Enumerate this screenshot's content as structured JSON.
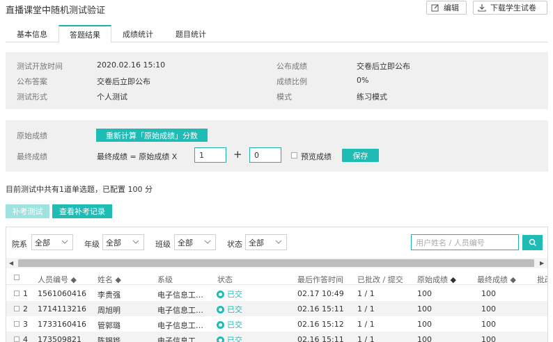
{
  "header": {
    "title": "直播课堂中随机测试验证",
    "edit_label": "编辑",
    "download_label": "下载学生试卷"
  },
  "tabs": [
    {
      "label": "基本信息"
    },
    {
      "label": "答题结果",
      "active": true
    },
    {
      "label": "成绩统计"
    },
    {
      "label": "题目统计"
    }
  ],
  "info": {
    "open_time_label": "测试开放时间",
    "open_time_value": "2020.02.16 15:10",
    "publish_score_label": "公布成绩",
    "publish_score_value": "交卷后立即公布",
    "publish_answer_label": "公布答案",
    "publish_answer_value": "交卷后立即公布",
    "score_ratio_label": "成绩比例",
    "score_ratio_value": "0%",
    "test_form_label": "测试形式",
    "test_form_value": "个人测试",
    "mode_label": "模式",
    "mode_value": "练习模式"
  },
  "score": {
    "raw_label": "原始成绩",
    "recalc_button": "重新计算「原始成绩」分数",
    "final_label": "最终成绩",
    "formula_text": "最终成绩 = 原始成绩 X",
    "multiplier": "1",
    "plus": "+",
    "offset": "0",
    "preview_label": "预览成绩",
    "save_button": "保存"
  },
  "summary": "目前测试中共有1道单选题，已配置 100 分",
  "actions": {
    "makeup_test": "补考测试",
    "view_makeup": "查看补考记录"
  },
  "filters": {
    "college_label": "院系",
    "college_value": "全部",
    "grade_label": "年级",
    "grade_value": "全部",
    "class_label": "班级",
    "class_value": "全部",
    "status_label": "状态",
    "status_value": "全部",
    "search_placeholder": "用户姓名 / 人员编号"
  },
  "table": {
    "columns": [
      "人员编号",
      "姓名",
      "系级",
      "状态",
      "最后作答时间",
      "已批改 / 提交",
      "原始成绩",
      "最终成绩",
      "批改"
    ],
    "rows": [
      {
        "index": "1",
        "id": "1561060416",
        "name": "李贵强",
        "dept": "电子信息工程系",
        "status": "已交",
        "time": "02.17 10:49",
        "graded": "1 / 1",
        "raw": "100",
        "final": "100"
      },
      {
        "index": "2",
        "id": "1714113216",
        "name": "周旭明",
        "dept": "电子信息工程系",
        "status": "已交",
        "time": "02.16 15:11",
        "graded": "1 / 1",
        "raw": "100",
        "final": "100"
      },
      {
        "index": "3",
        "id": "1733160416",
        "name": "管郭璐",
        "dept": "电子信息工程系",
        "status": "已交",
        "time": "02.16 15:12",
        "graded": "1 / 1",
        "raw": "100",
        "final": "100"
      },
      {
        "index": "4",
        "id": "173509821",
        "name": "陈锡铧",
        "dept": "电子信息工程系",
        "status": "已交",
        "time": "02.16 15:11",
        "graded": "1 / 1",
        "raw": "100",
        "final": "100"
      }
    ]
  },
  "colors": {
    "accent": "#1fbcb6",
    "disabled": "#9ee3e0",
    "panel_bg": "#f0f0f0"
  }
}
